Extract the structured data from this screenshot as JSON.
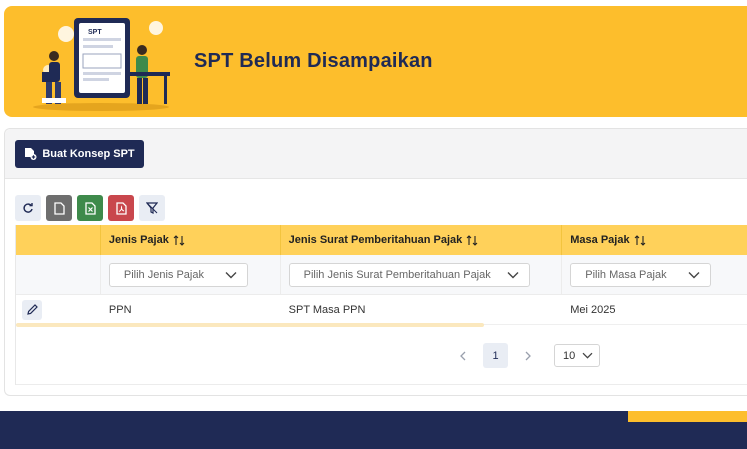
{
  "header": {
    "title": "SPT Belum Disampaikan",
    "illustration_badge": "SPT"
  },
  "toolbar": {
    "create_label": "Buat Konsep SPT"
  },
  "table": {
    "columns": [
      "",
      "Jenis Pajak",
      "Jenis Surat Pemberitahuan Pajak",
      "Masa Pajak"
    ],
    "filters": {
      "jenis_pajak": "Pilih Jenis Pajak",
      "jenis_surat": "Pilih Jenis Surat Pemberitahuan Pajak",
      "masa_pajak": "Pilih Masa Pajak"
    },
    "rows": [
      {
        "jenis_pajak": "PPN",
        "jenis_surat": "SPT Masa PPN",
        "masa_pajak": "Mei 2025"
      }
    ]
  },
  "pagination": {
    "current_page": "1",
    "page_size": "10"
  },
  "icons": {
    "refresh": "refresh-icon",
    "file": "file-icon",
    "excel": "excel-icon",
    "pdf": "pdf-icon",
    "clear_filter": "filter-clear-icon",
    "edit": "pencil-icon"
  },
  "colors": {
    "primary": "#1F2A55",
    "accent": "#FDBE2C",
    "header_row": "#FFD15A"
  }
}
